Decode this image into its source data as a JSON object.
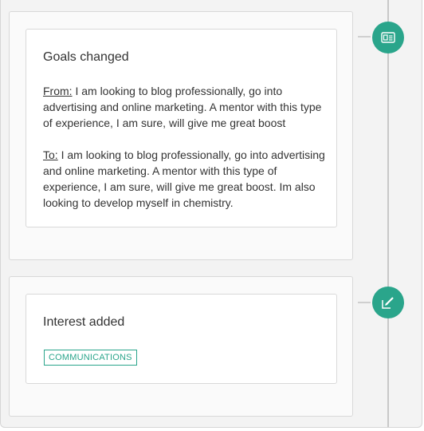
{
  "events": [
    {
      "title": "Goals changed",
      "from_prefix": "From:",
      "from_text": " I am looking to blog professionally, go into advertising and online marketing. A mentor with this type of experience, I am sure, will give me great boost",
      "to_prefix": "To:",
      "to_text": " I am looking to blog professionally, go into advertising and online marketing. A mentor with this type of experience, I am sure, will give me great boost. Im also looking to develop myself in chemistry.",
      "icon": "id-card-icon"
    },
    {
      "title": "Interest added",
      "tag": "COMMUNICATIONS",
      "icon": "pencil-edit-icon"
    }
  ],
  "colors": {
    "accent": "#2aa58b",
    "background": "#f3f3f3",
    "timeline": "#c8c8c8"
  }
}
